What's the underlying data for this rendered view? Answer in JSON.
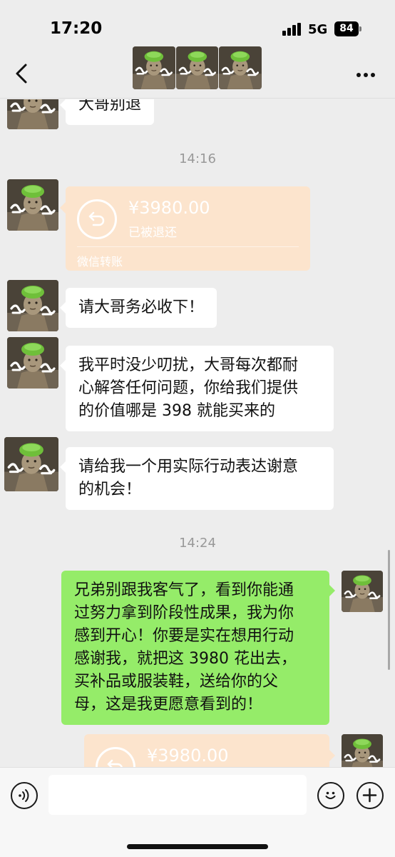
{
  "status_bar": {
    "time": "17:20",
    "network": "5G",
    "battery": "84"
  },
  "nav": {
    "back_icon": "chevron-left-icon",
    "more_icon": "more-dots-icon",
    "group_avatar_count": 3
  },
  "chat": {
    "messages": [
      {
        "type": "text",
        "side": "left",
        "text": "大哥别退"
      },
      {
        "type": "time",
        "text": "14:16"
      },
      {
        "type": "transfer",
        "side": "left",
        "amount": "¥3980.00",
        "status": "已被退还",
        "label": "微信转账"
      },
      {
        "type": "text",
        "side": "left",
        "text": "请大哥务必收下！"
      },
      {
        "type": "text",
        "side": "left",
        "lines": [
          "我平时没少叨扰，大哥每次都耐",
          "心解答任何问题，你给我们提供",
          "的价值哪是 398 就能买来的"
        ]
      },
      {
        "type": "text",
        "side": "left",
        "lines": [
          "请给我一个用实际行动表达谢意",
          "的机会！"
        ]
      },
      {
        "type": "time",
        "text": "14:24"
      },
      {
        "type": "text",
        "side": "right",
        "lines": [
          "兄弟别跟我客气了，看到你能通",
          "过努力拿到阶段性成果，我为你",
          "感到开心！你要是实在想用行动",
          "感谢我，就把这 3980 花出去，",
          "买补品或服装鞋，送给你的父",
          "母，这是我更愿意看到的！"
        ]
      },
      {
        "type": "transfer",
        "side": "right",
        "amount": "¥3980.00"
      }
    ]
  },
  "input_bar": {
    "placeholder": "",
    "voice_icon": "voice-icon",
    "emoji_icon": "emoji-icon",
    "plus_icon": "plus-icon"
  },
  "colors": {
    "background": "#ededed",
    "bubble_left": "#ffffff",
    "bubble_right": "#95ec69",
    "transfer": "#fce4cd"
  }
}
